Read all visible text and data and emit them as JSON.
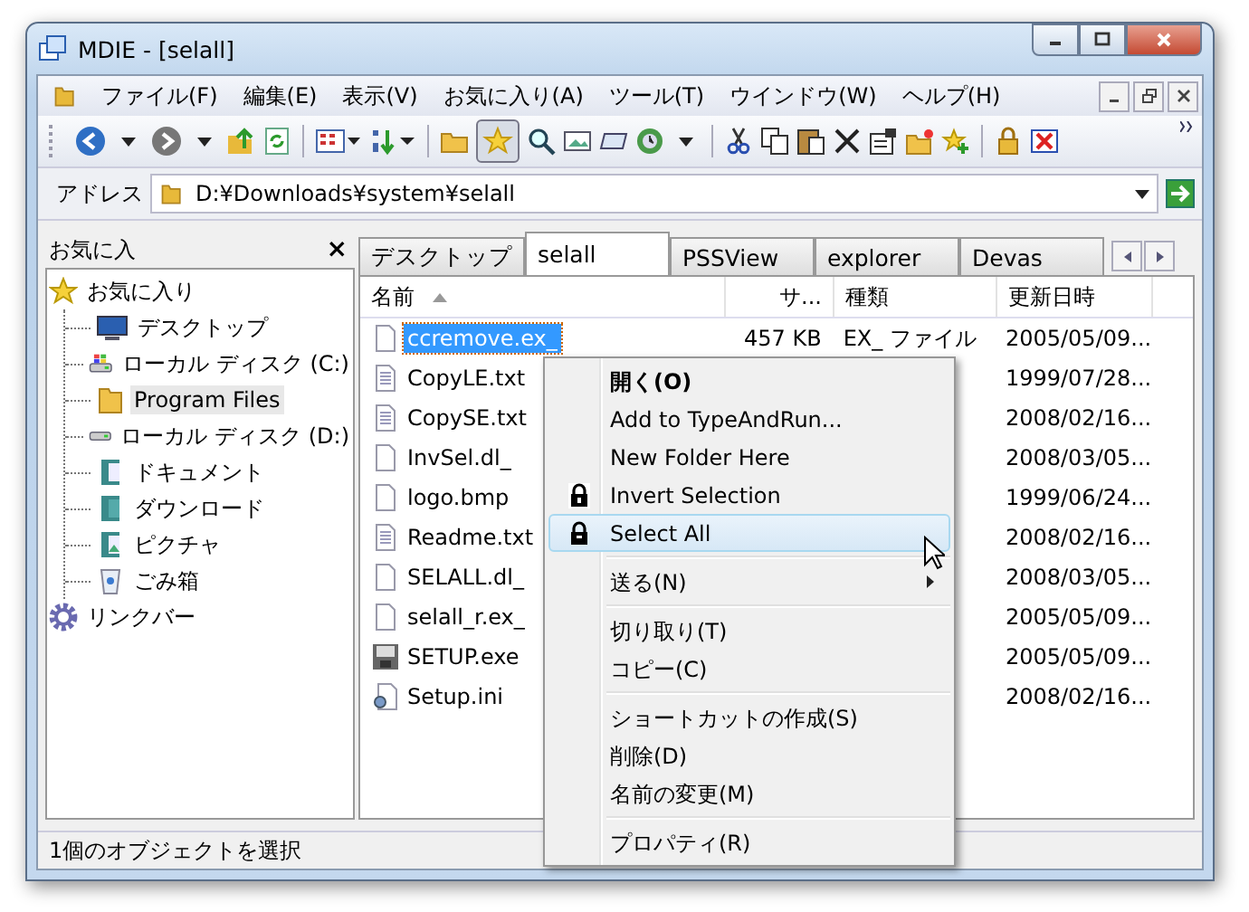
{
  "window": {
    "title": "MDIE - [selall]"
  },
  "menu": [
    "ファイル(F)",
    "編集(E)",
    "表示(V)",
    "お気に入り(A)",
    "ツール(T)",
    "ウインドウ(W)",
    "ヘルプ(H)"
  ],
  "address": {
    "label": "アドレス",
    "value": "D:¥Downloads¥system¥selall"
  },
  "favorites_pane": {
    "title": "お気に入",
    "close": "×",
    "tree": [
      {
        "label": "お気に入り",
        "kind": "star",
        "selected": false,
        "children": [
          {
            "label": "デスクトップ",
            "kind": "desktop",
            "selected": false
          },
          {
            "label": "ローカル ディスク (C:)",
            "kind": "system-drive",
            "selected": false
          },
          {
            "label": "Program Files",
            "kind": "folder",
            "selected": true
          },
          {
            "label": "ローカル ディスク (D:)",
            "kind": "drive",
            "selected": false
          },
          {
            "label": "ドキュメント",
            "kind": "documents",
            "selected": false
          },
          {
            "label": "ダウンロード",
            "kind": "downloads",
            "selected": false
          },
          {
            "label": "ピクチャ",
            "kind": "pictures",
            "selected": false
          },
          {
            "label": "ごみ箱",
            "kind": "recycle",
            "selected": false
          }
        ]
      },
      {
        "label": "リンクバー",
        "kind": "gear",
        "selected": false
      }
    ]
  },
  "tabs": [
    {
      "label": "デスクトップ",
      "selected": false
    },
    {
      "label": "selall",
      "selected": true
    },
    {
      "label": "PSSView",
      "selected": false
    },
    {
      "label": "explorer",
      "selected": false
    },
    {
      "label": "Devas",
      "selected": false
    }
  ],
  "table": {
    "columns": [
      "名前",
      "サ...",
      "種類",
      "更新日時"
    ],
    "rows": [
      {
        "name": "ccremove.ex_",
        "kind": "file",
        "size": "457 KB",
        "type": "EX_ ファイル",
        "modified": "2005/05/09...",
        "selected": true
      },
      {
        "name": "CopyLE.txt",
        "kind": "text",
        "modified": "1999/07/28...",
        "selected": false
      },
      {
        "name": "CopySE.txt",
        "kind": "text",
        "modified": "2008/02/16...",
        "selected": false
      },
      {
        "name": "InvSel.dl_",
        "kind": "file",
        "modified": "2008/03/05...",
        "selected": false
      },
      {
        "name": "logo.bmp",
        "kind": "file",
        "modified": "1999/06/24...",
        "selected": false
      },
      {
        "name": "Readme.txt",
        "kind": "text",
        "modified": "2008/02/16...",
        "selected": false
      },
      {
        "name": "SELALL.dl_",
        "kind": "file",
        "modified": "2008/03/05...",
        "selected": false
      },
      {
        "name": "selall_r.ex_",
        "kind": "file",
        "modified": "2005/05/09...",
        "selected": false
      },
      {
        "name": "SETUP.exe",
        "kind": "setup",
        "modified": "2005/05/09...",
        "selected": false
      },
      {
        "name": "Setup.ini",
        "kind": "ini",
        "modified": "2008/02/16...",
        "selected": false
      }
    ]
  },
  "context_menu": [
    {
      "kind": "item",
      "label": "開く(O)",
      "default": true,
      "selected": false
    },
    {
      "kind": "item",
      "label": "Add to TypeAndRun...",
      "default": false,
      "selected": false
    },
    {
      "kind": "item",
      "label": "New Folder Here",
      "default": false,
      "selected": false
    },
    {
      "kind": "icon-item",
      "label": "Invert Selection",
      "default": false,
      "selected": false
    },
    {
      "kind": "icon-item",
      "label": "Select All",
      "default": false,
      "selected": true
    },
    {
      "kind": "separator"
    },
    {
      "kind": "item",
      "label": "送る(N)",
      "default": false,
      "selected": false,
      "submenu": true
    },
    {
      "kind": "separator"
    },
    {
      "kind": "item",
      "label": "切り取り(T)",
      "default": false,
      "selected": false
    },
    {
      "kind": "item",
      "label": "コピー(C)",
      "default": false,
      "selected": false
    },
    {
      "kind": "separator"
    },
    {
      "kind": "item",
      "label": "ショートカットの作成(S)",
      "default": false,
      "selected": false
    },
    {
      "kind": "item",
      "label": "削除(D)",
      "default": false,
      "selected": false
    },
    {
      "kind": "item",
      "label": "名前の変更(M)",
      "default": false,
      "selected": false
    },
    {
      "kind": "separator"
    },
    {
      "kind": "item",
      "label": "プロパティ(R)",
      "default": false,
      "selected": false
    }
  ],
  "status_bar": "1個のオブジェクトを選択"
}
